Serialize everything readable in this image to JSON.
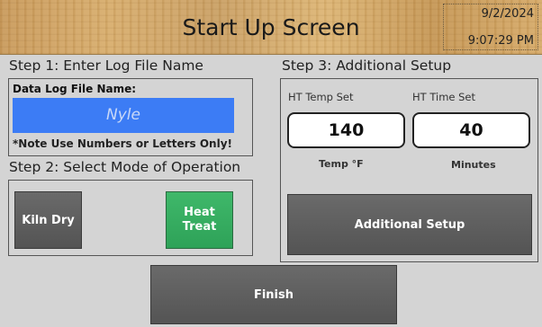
{
  "header": {
    "title": "Start Up Screen",
    "date": "9/2/2024",
    "time": "9:07:29 PM"
  },
  "step1": {
    "label": "Step 1:  Enter Log File Name",
    "field_label": "Data Log File Name:",
    "file_name": "Nyle",
    "note": "*Note Use Numbers or Letters Only!"
  },
  "step2": {
    "label": "Step 2:  Select Mode of Operation",
    "buttons": {
      "kiln_dry": "Kiln Dry",
      "heat_treat_line1": "Heat",
      "heat_treat_line2": "Treat"
    }
  },
  "step3": {
    "label": "Step 3:  Additional Setup",
    "temp_label": "HT Temp Set",
    "time_label": "HT Time Set",
    "temp_value": "140",
    "time_value": "40",
    "temp_unit": "Temp °F",
    "time_unit": "Minutes",
    "additional_setup_button": "Additional Setup"
  },
  "footer": {
    "finish_button": "Finish"
  },
  "colors": {
    "active_mode": "#2ea258",
    "input_bg": "#3c7cf5",
    "button_bg": "#5e5e5e"
  }
}
